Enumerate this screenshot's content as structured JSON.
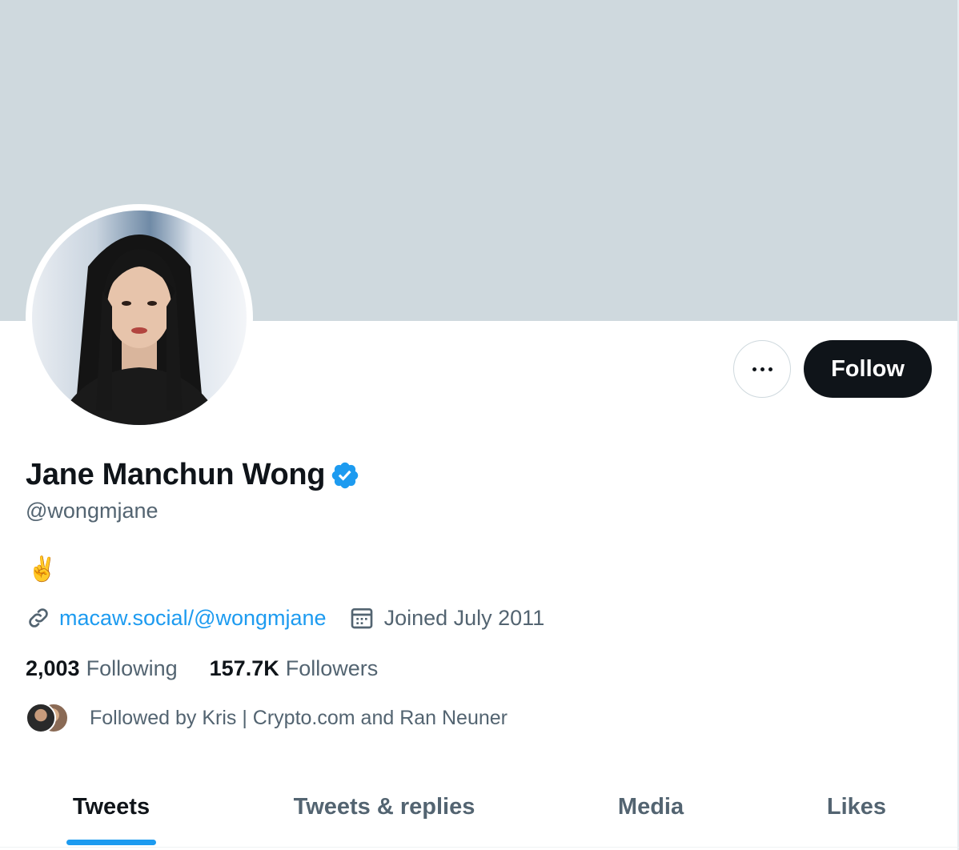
{
  "profile": {
    "name": "Jane Manchun Wong",
    "handle": "@wongmjane",
    "bio": "✌️",
    "website": "macaw.social/@wongmjane",
    "joined": "Joined July 2011",
    "following_count": "2,003",
    "following_label": "Following",
    "followers_count": "157.7K",
    "followers_label": "Followers",
    "followed_by": "Followed by Kris | Crypto.com and Ran Neuner"
  },
  "actions": {
    "follow_label": "Follow"
  },
  "tabs": [
    {
      "label": "Tweets",
      "active": true
    },
    {
      "label": "Tweets & replies",
      "active": false
    },
    {
      "label": "Media",
      "active": false
    },
    {
      "label": "Likes",
      "active": false
    }
  ],
  "colors": {
    "banner": "#cfd9de",
    "accent": "#1d9bf0",
    "text_primary": "#0f1419",
    "text_secondary": "#536471"
  },
  "icons": {
    "verified": "verified-badge-icon",
    "link": "link-icon",
    "calendar": "calendar-icon",
    "more": "more-horizontal-icon"
  }
}
